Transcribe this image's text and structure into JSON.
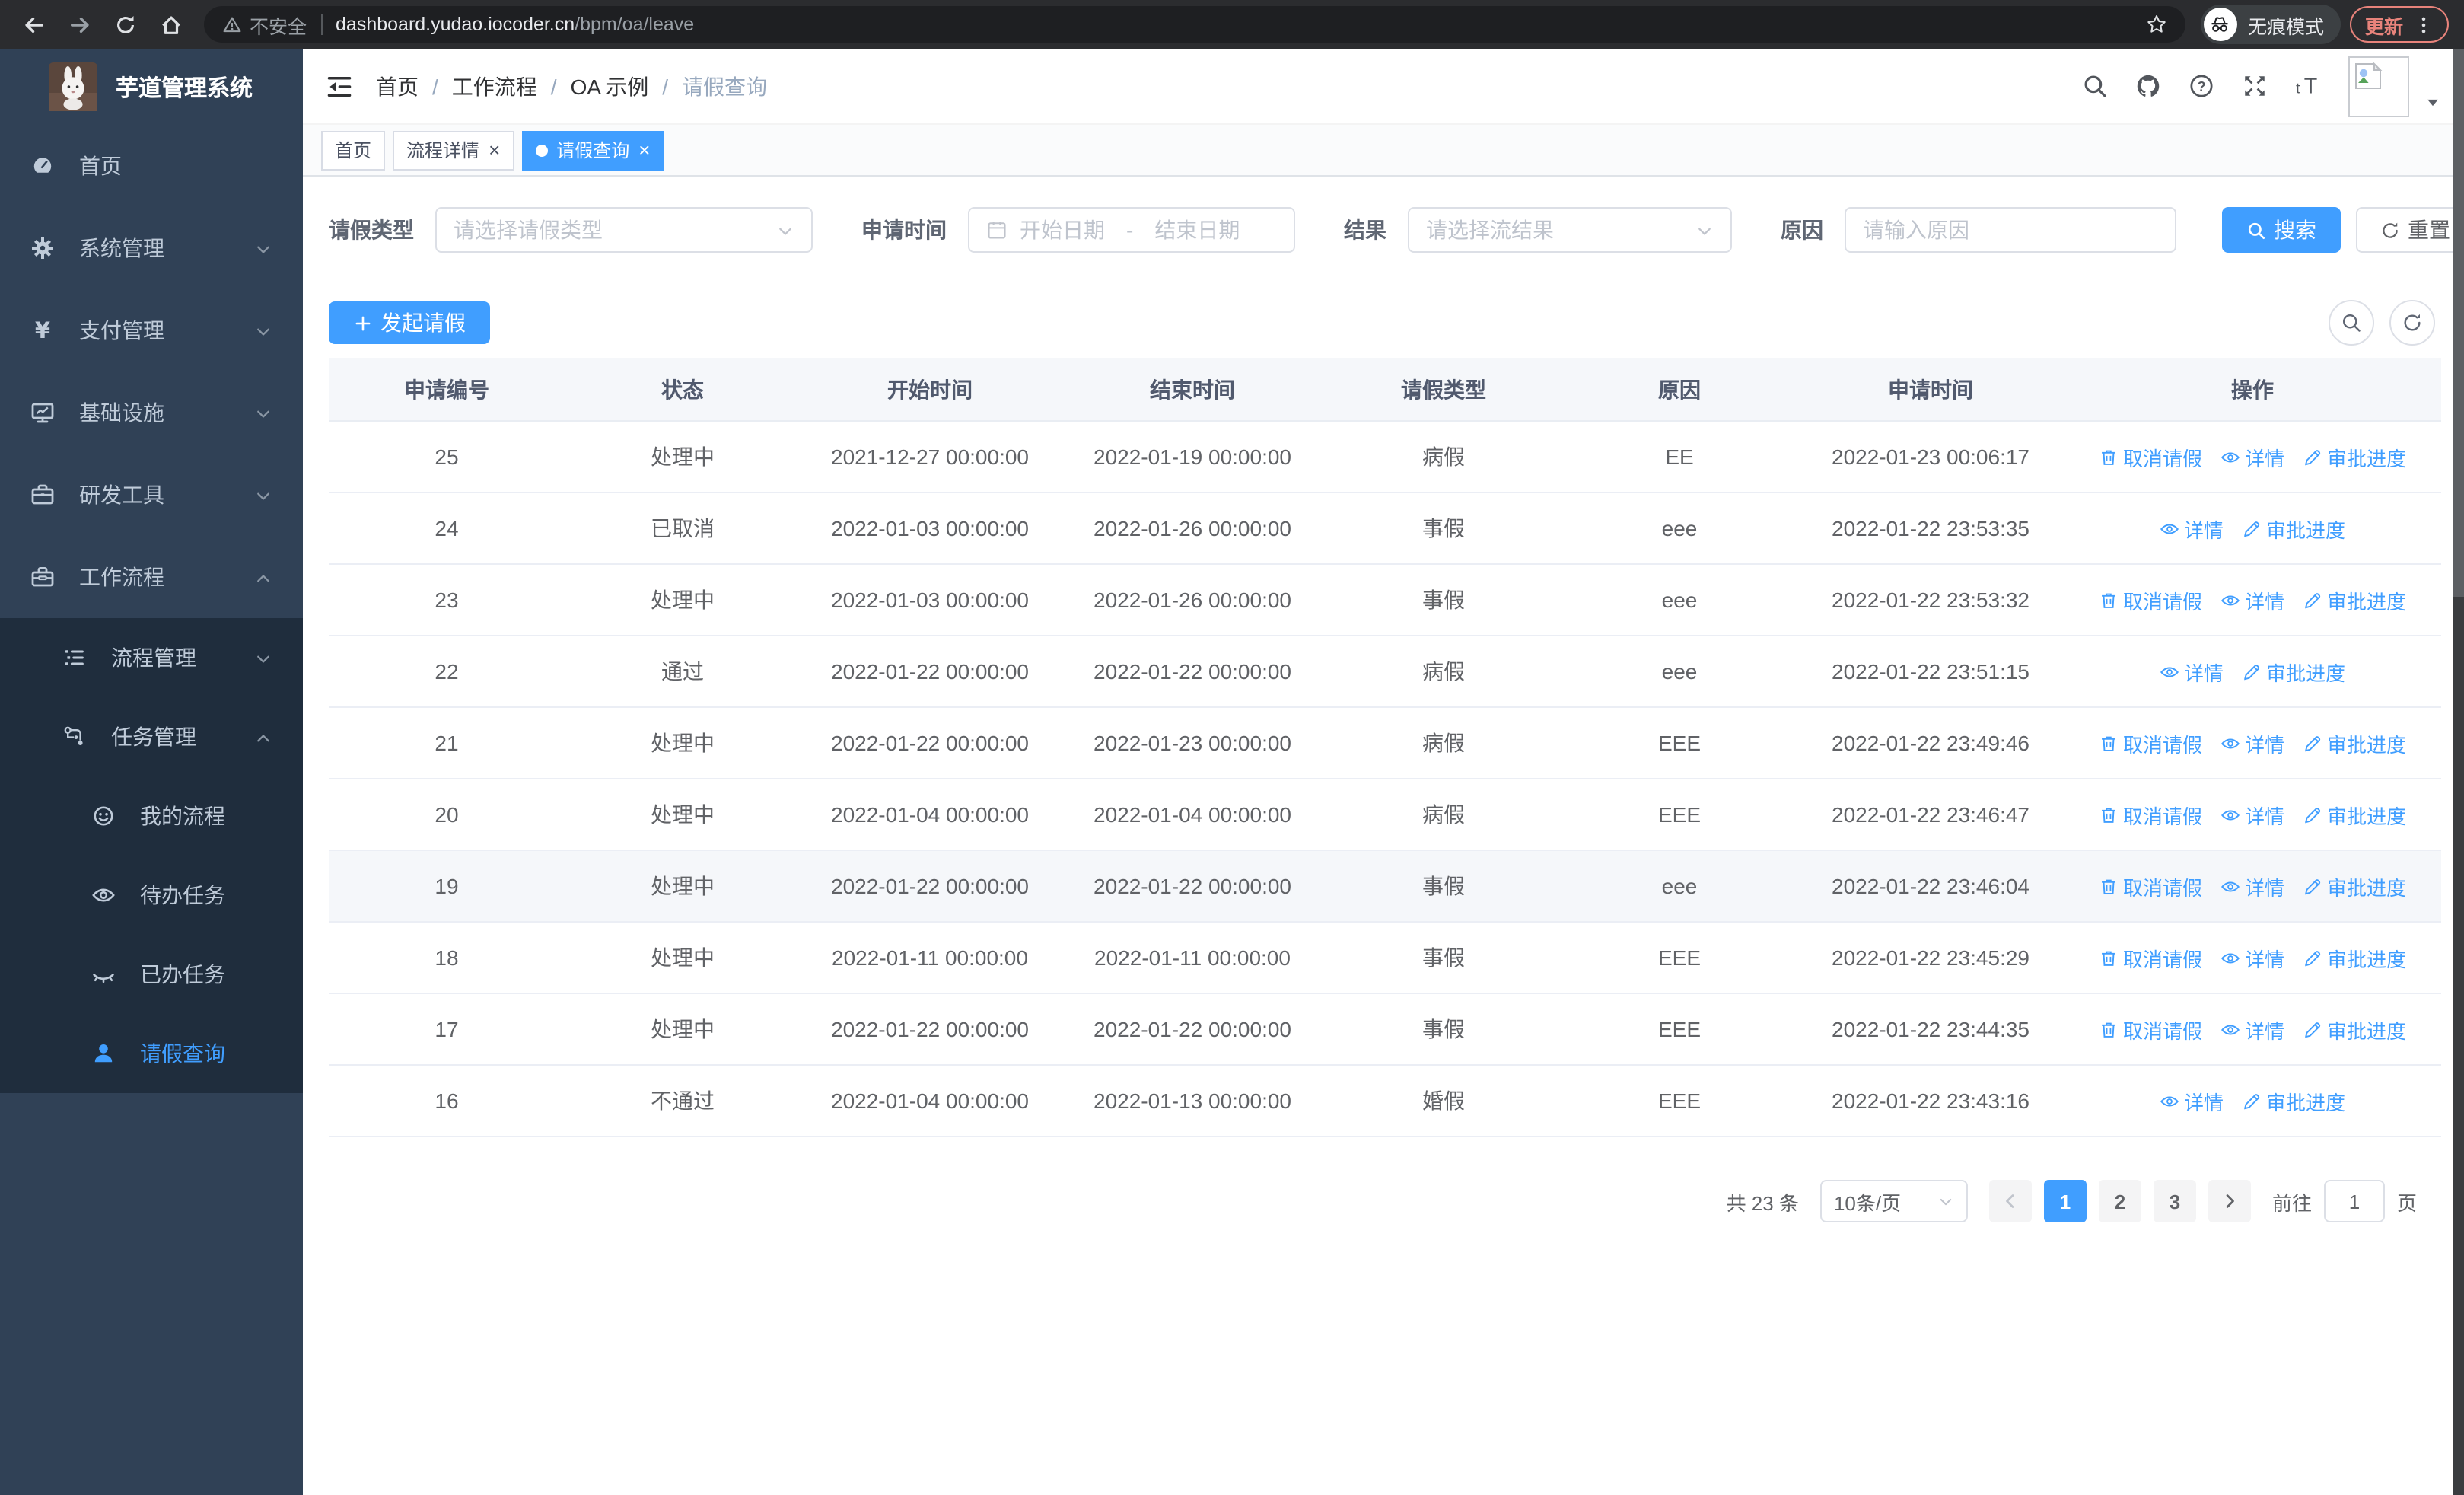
{
  "browser": {
    "security_label": "不安全",
    "url_host": "dashboard.yudao.iocoder.cn",
    "url_path": "/bpm/oa/leave",
    "incognito_label": "无痕模式",
    "update_label": "更新"
  },
  "sidebar": {
    "app_title": "芋道管理系统",
    "menu": [
      {
        "key": "home",
        "label": "首页",
        "icon": "dashboard-icon",
        "level": 0,
        "sub": false,
        "active": false,
        "chevron": ""
      },
      {
        "key": "system",
        "label": "系统管理",
        "icon": "gear-icon",
        "level": 0,
        "sub": false,
        "active": false,
        "chevron": "down"
      },
      {
        "key": "payment",
        "label": "支付管理",
        "icon": "yen-icon",
        "level": 0,
        "sub": false,
        "active": false,
        "chevron": "down"
      },
      {
        "key": "infrastructure",
        "label": "基础设施",
        "icon": "monitor-icon",
        "level": 0,
        "sub": false,
        "active": false,
        "chevron": "down"
      },
      {
        "key": "dev-tools",
        "label": "研发工具",
        "icon": "briefcase-icon",
        "level": 0,
        "sub": false,
        "active": false,
        "chevron": "down"
      },
      {
        "key": "workflow",
        "label": "工作流程",
        "icon": "toolbox-icon",
        "level": 0,
        "sub": false,
        "active": false,
        "chevron": "up"
      },
      {
        "key": "process-mgmt",
        "label": "流程管理",
        "icon": "list-icon",
        "level": 1,
        "sub": true,
        "active": false,
        "chevron": "down"
      },
      {
        "key": "task-mgmt",
        "label": "任务管理",
        "icon": "flow-icon",
        "level": 1,
        "sub": true,
        "active": false,
        "chevron": "up"
      },
      {
        "key": "my-process",
        "label": "我的流程",
        "icon": "face-icon",
        "level": 2,
        "sub": true,
        "active": false,
        "chevron": ""
      },
      {
        "key": "todo-tasks",
        "label": "待办任务",
        "icon": "eye-open-icon",
        "level": 2,
        "sub": true,
        "active": false,
        "chevron": ""
      },
      {
        "key": "done-tasks",
        "label": "已办任务",
        "icon": "eye-closed-icon",
        "level": 2,
        "sub": true,
        "active": false,
        "chevron": ""
      },
      {
        "key": "leave-query",
        "label": "请假查询",
        "icon": "user-icon",
        "level": 2,
        "sub": true,
        "active": true,
        "chevron": ""
      }
    ]
  },
  "breadcrumb": {
    "items": [
      "首页",
      "工作流程",
      "OA 示例",
      "请假查询"
    ],
    "separator": "/"
  },
  "tabs": [
    {
      "key": "home",
      "label": "首页",
      "active": false,
      "closable": false
    },
    {
      "key": "process-detail",
      "label": "流程详情",
      "active": false,
      "closable": true
    },
    {
      "key": "leave-query",
      "label": "请假查询",
      "active": true,
      "closable": true
    }
  ],
  "filters": {
    "leave_type": {
      "label": "请假类型",
      "placeholder": "请选择请假类型"
    },
    "apply_time": {
      "label": "申请时间",
      "start_placeholder": "开始日期",
      "separator": "-",
      "end_placeholder": "结束日期"
    },
    "result": {
      "label": "结果",
      "placeholder": "请选择流结果"
    },
    "reason": {
      "label": "原因",
      "placeholder": "请输入原因"
    },
    "search_label": "搜索",
    "reset_label": "重置"
  },
  "toolbar": {
    "create_label": "发起请假"
  },
  "table": {
    "headers": [
      "申请编号",
      "状态",
      "开始时间",
      "结束时间",
      "请假类型",
      "原因",
      "申请时间",
      "操作"
    ],
    "action_labels": {
      "cancel": "取消请假",
      "detail": "详情",
      "progress": "审批进度"
    },
    "rows": [
      {
        "id": "25",
        "status": "处理中",
        "start": "2021-12-27 00:00:00",
        "end": "2022-01-19 00:00:00",
        "type": "病假",
        "reason": "EE",
        "apply_time": "2022-01-23 00:06:17",
        "actions": [
          "cancel",
          "detail",
          "progress"
        ],
        "highlight": false
      },
      {
        "id": "24",
        "status": "已取消",
        "start": "2022-01-03 00:00:00",
        "end": "2022-01-26 00:00:00",
        "type": "事假",
        "reason": "eee",
        "apply_time": "2022-01-22 23:53:35",
        "actions": [
          "detail",
          "progress"
        ],
        "highlight": false
      },
      {
        "id": "23",
        "status": "处理中",
        "start": "2022-01-03 00:00:00",
        "end": "2022-01-26 00:00:00",
        "type": "事假",
        "reason": "eee",
        "apply_time": "2022-01-22 23:53:32",
        "actions": [
          "cancel",
          "detail",
          "progress"
        ],
        "highlight": false
      },
      {
        "id": "22",
        "status": "通过",
        "start": "2022-01-22 00:00:00",
        "end": "2022-01-22 00:00:00",
        "type": "病假",
        "reason": "eee",
        "apply_time": "2022-01-22 23:51:15",
        "actions": [
          "detail",
          "progress"
        ],
        "highlight": false
      },
      {
        "id": "21",
        "status": "处理中",
        "start": "2022-01-22 00:00:00",
        "end": "2022-01-23 00:00:00",
        "type": "病假",
        "reason": "EEE",
        "apply_time": "2022-01-22 23:49:46",
        "actions": [
          "cancel",
          "detail",
          "progress"
        ],
        "highlight": false
      },
      {
        "id": "20",
        "status": "处理中",
        "start": "2022-01-04 00:00:00",
        "end": "2022-01-04 00:00:00",
        "type": "病假",
        "reason": "EEE",
        "apply_time": "2022-01-22 23:46:47",
        "actions": [
          "cancel",
          "detail",
          "progress"
        ],
        "highlight": false
      },
      {
        "id": "19",
        "status": "处理中",
        "start": "2022-01-22 00:00:00",
        "end": "2022-01-22 00:00:00",
        "type": "事假",
        "reason": "eee",
        "apply_time": "2022-01-22 23:46:04",
        "actions": [
          "cancel",
          "detail",
          "progress"
        ],
        "highlight": true
      },
      {
        "id": "18",
        "status": "处理中",
        "start": "2022-01-11 00:00:00",
        "end": "2022-01-11 00:00:00",
        "type": "事假",
        "reason": "EEE",
        "apply_time": "2022-01-22 23:45:29",
        "actions": [
          "cancel",
          "detail",
          "progress"
        ],
        "highlight": false
      },
      {
        "id": "17",
        "status": "处理中",
        "start": "2022-01-22 00:00:00",
        "end": "2022-01-22 00:00:00",
        "type": "事假",
        "reason": "EEE",
        "apply_time": "2022-01-22 23:44:35",
        "actions": [
          "cancel",
          "detail",
          "progress"
        ],
        "highlight": false
      },
      {
        "id": "16",
        "status": "不通过",
        "start": "2022-01-04 00:00:00",
        "end": "2022-01-13 00:00:00",
        "type": "婚假",
        "reason": "EEE",
        "apply_time": "2022-01-22 23:43:16",
        "actions": [
          "detail",
          "progress"
        ],
        "highlight": false
      }
    ]
  },
  "pagination": {
    "total_label": "共 23 条",
    "page_size": "10条/页",
    "pages": [
      "1",
      "2",
      "3"
    ],
    "current": "1",
    "goto_label": "前往",
    "goto_value": "1",
    "page_unit": "页"
  },
  "colors": {
    "accent": "#409eff",
    "sidebar_bg": "#304156",
    "submenu_bg": "#1f2d3d",
    "update_red": "#e8837b"
  }
}
